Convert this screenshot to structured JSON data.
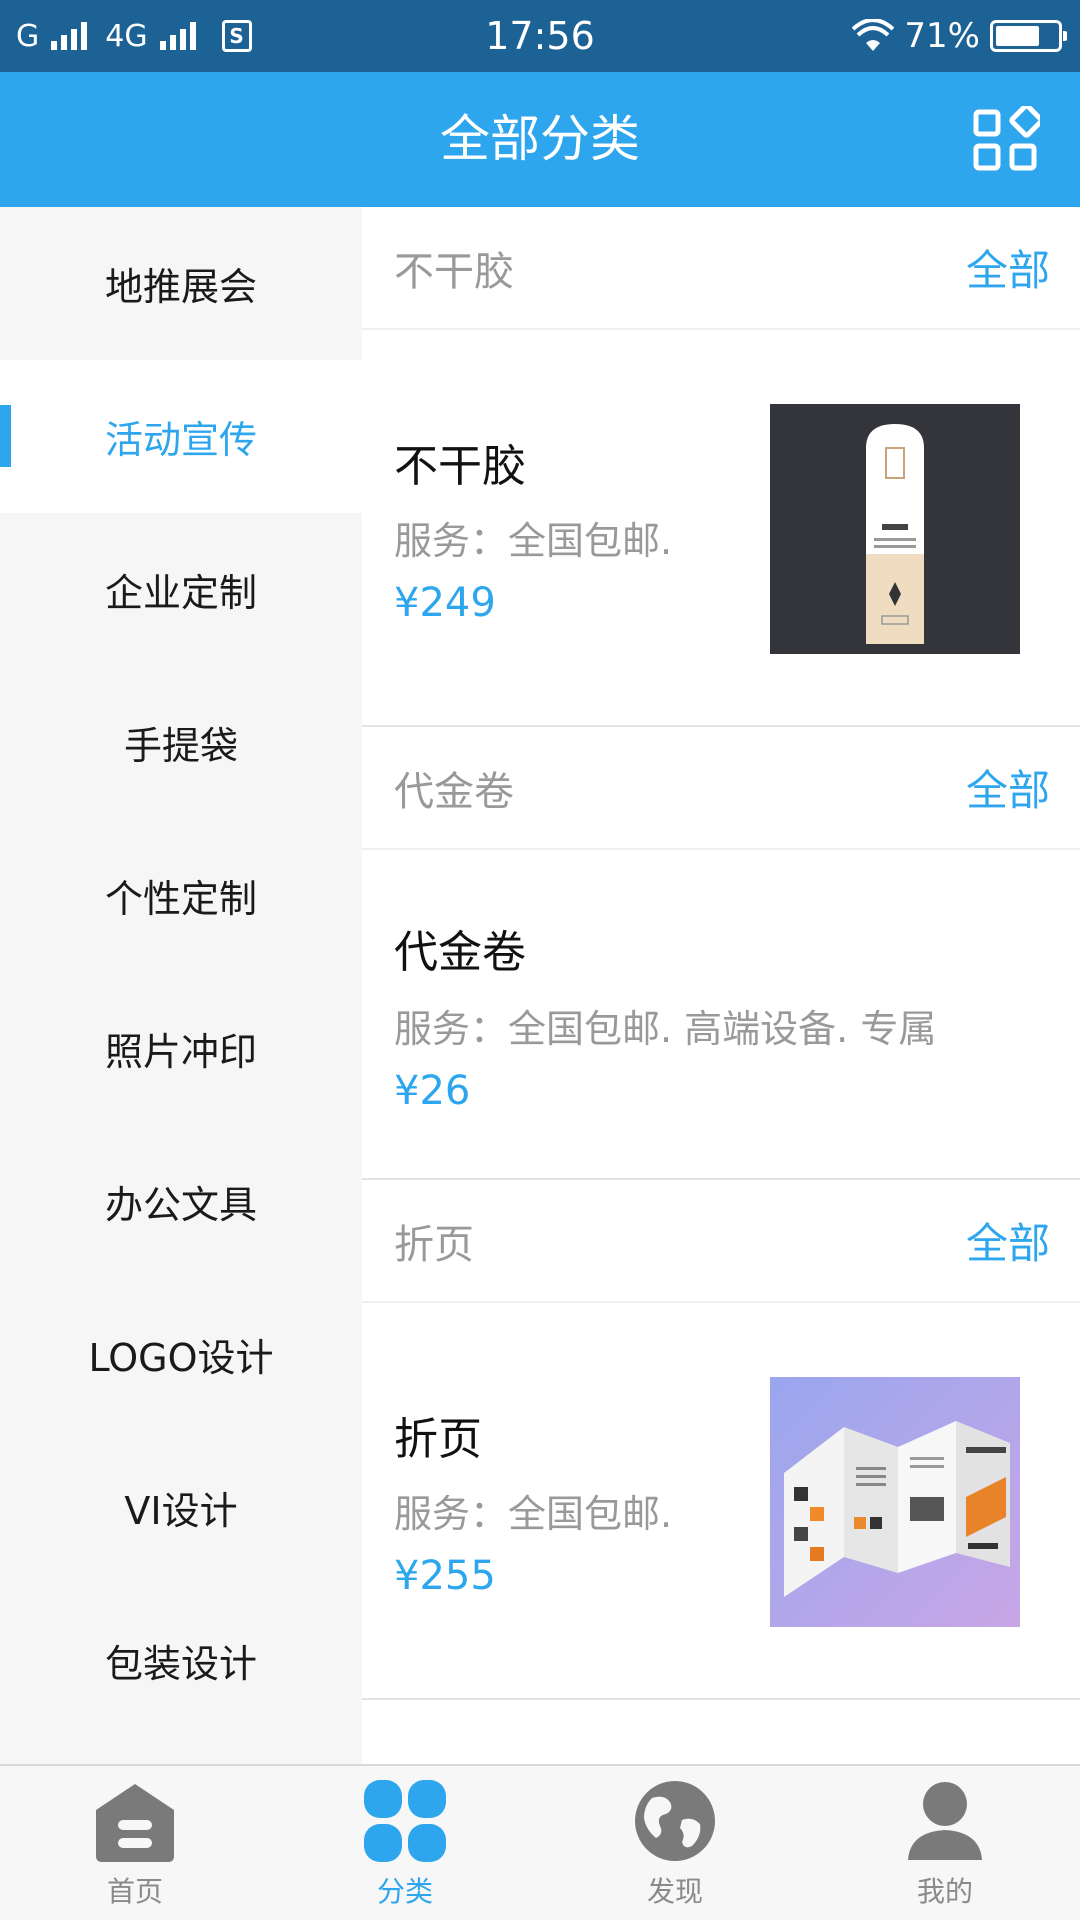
{
  "status_bar": {
    "carrier1": "G",
    "carrier2": "4G",
    "sim_icon": "S",
    "time": "17:56",
    "battery": "71%",
    "battery_level": 0.71
  },
  "header": {
    "title": "全部分类",
    "grid_icon": "grid-icon"
  },
  "sidebar": {
    "items": [
      {
        "label": "地推展会"
      },
      {
        "label": "活动宣传"
      },
      {
        "label": "企业定制"
      },
      {
        "label": "手提袋"
      },
      {
        "label": "个性定制"
      },
      {
        "label": "照片冲印"
      },
      {
        "label": "办公文具"
      },
      {
        "label": "LOGO设计"
      },
      {
        "label": "VI设计"
      },
      {
        "label": "包装设计"
      }
    ],
    "active_index": 1
  },
  "sections": [
    {
      "title": "不干胶",
      "all_label": "全部",
      "product": {
        "name": "不干胶",
        "service": "服务：全国包邮.",
        "price": "¥249"
      }
    },
    {
      "title": "代金卷",
      "all_label": "全部",
      "product": {
        "name": "代金卷",
        "service": "服务：全国包邮. 高端设备. 专属",
        "price": "¥26"
      }
    },
    {
      "title": "折页",
      "all_label": "全部",
      "product": {
        "name": "折页",
        "service": "服务：全国包邮.",
        "price": "¥255"
      }
    }
  ],
  "tabbar": {
    "items": [
      {
        "label": "首页",
        "icon": "home-icon"
      },
      {
        "label": "分类",
        "icon": "category-icon"
      },
      {
        "label": "发现",
        "icon": "globe-icon"
      },
      {
        "label": "我的",
        "icon": "user-icon"
      }
    ],
    "active_index": 1
  },
  "colors": {
    "status_bar": "#1c6295",
    "accent": "#2ea6ee",
    "muted_text": "#999999",
    "sidebar_bg": "#f6f6f6"
  }
}
